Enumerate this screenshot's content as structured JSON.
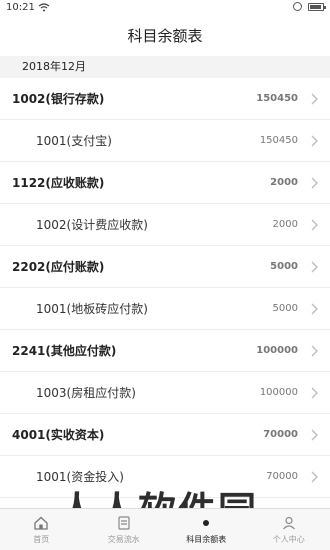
{
  "status": {
    "time": "10:21"
  },
  "header": {
    "title": "科目余额表"
  },
  "period": "2018年12月",
  "accounts": [
    {
      "name": "1002(银行存款)",
      "amount": "150450",
      "level": "parent"
    },
    {
      "name": "1001(支付宝)",
      "amount": "150450",
      "level": "child"
    },
    {
      "name": "1122(应收账款)",
      "amount": "2000",
      "level": "parent"
    },
    {
      "name": "1002(设计费应收款)",
      "amount": "2000",
      "level": "child"
    },
    {
      "name": "2202(应付账款)",
      "amount": "5000",
      "level": "parent"
    },
    {
      "name": "1001(地板砖应付款)",
      "amount": "5000",
      "level": "child"
    },
    {
      "name": "2241(其他应付款)",
      "amount": "100000",
      "level": "parent"
    },
    {
      "name": "1003(房租应付款)",
      "amount": "100000",
      "level": "child"
    },
    {
      "name": "4001(实收资本)",
      "amount": "70000",
      "level": "parent"
    },
    {
      "name": "1001(资金投入)",
      "amount": "70000",
      "level": "child"
    }
  ],
  "tabs": [
    {
      "label": "首页",
      "icon": "home-icon",
      "active": false
    },
    {
      "label": "交易流水",
      "icon": "transactions-icon",
      "active": false
    },
    {
      "label": "科目余额表",
      "icon": "balance-sheet-icon",
      "active": true
    },
    {
      "label": "个人中心",
      "icon": "user-icon",
      "active": false
    }
  ],
  "watermark": "人人软件园"
}
